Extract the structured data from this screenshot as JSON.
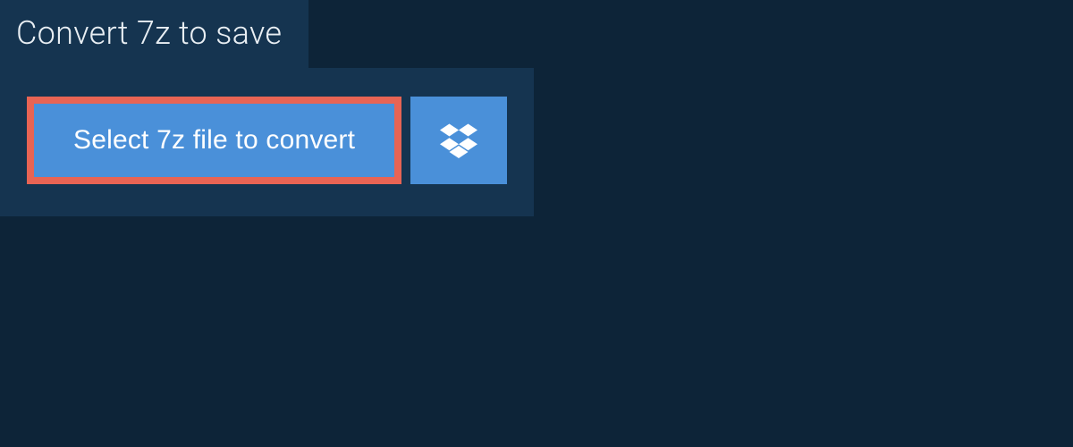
{
  "tab": {
    "title": "Convert 7z to save"
  },
  "panel": {
    "select_label": "Select 7z file to convert"
  }
}
